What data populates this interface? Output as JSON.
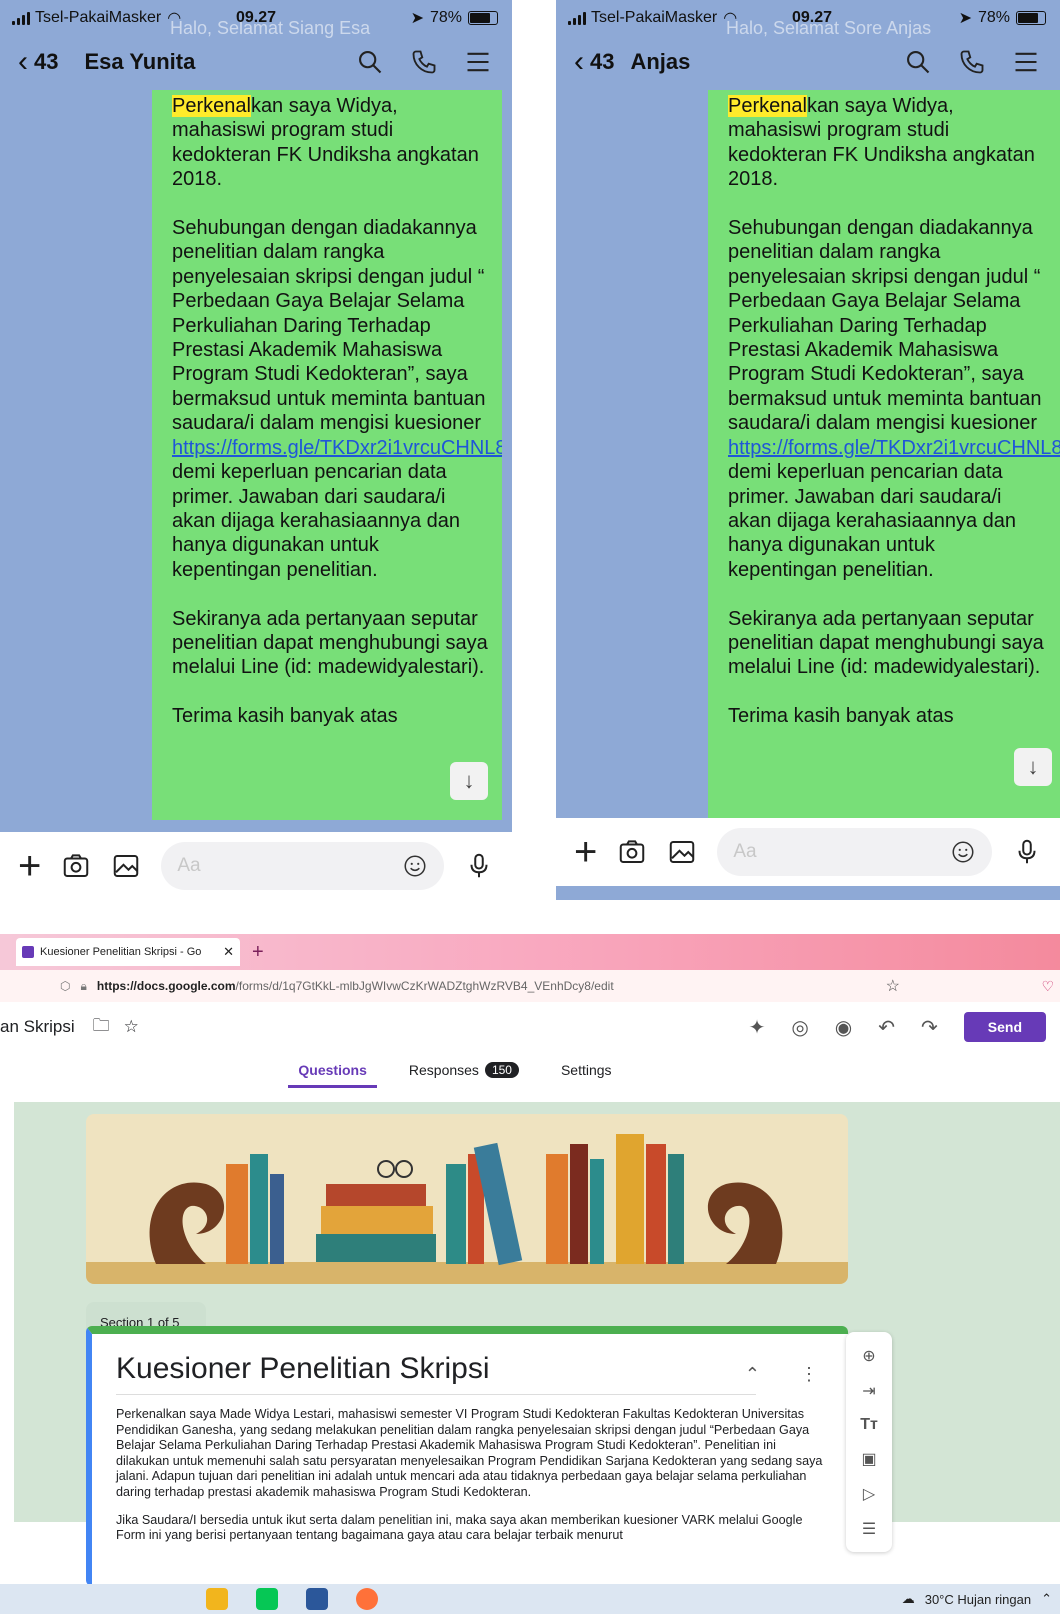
{
  "left_phone": {
    "status": {
      "carrier": "Tsel-PakaiMasker",
      "time": "09.27",
      "battery": "78%"
    },
    "banner": "Halo, Selamat Siang Esa",
    "chat": {
      "back_count": "43",
      "contact": "Esa Yunita"
    },
    "message": {
      "highlight": "Perkenal",
      "p1_rest": "kan saya Widya, mahasiswi program studi kedokteran FK Undiksha angkatan 2018.",
      "p2_before_link": "Sehubungan dengan diadakannya penelitian dalam rangka penyelesaian skripsi dengan judul “ Perbedaan Gaya Belajar Selama Perkuliahan Daring Terhadap Prestasi Akademik Mahasiswa Program Studi Kedokteran”, saya bermaksud untuk meminta bantuan saudara/i dalam mengisi kuesioner ",
      "link": "https://forms.gle/TKDxr2i1vrcuCHNL8",
      "p2_after_link": " demi keperluan pencarian data primer. Jawaban dari saudara/i akan dijaga kerahasiaannya dan hanya digunakan untuk kepentingan penelitian.",
      "p3": "Sekiranya ada pertanyaan seputar penelitian dapat menghubungi saya melalui Line (id: madewidyalestari).",
      "p4": "Terima kasih banyak atas"
    },
    "input_placeholder": "Aa"
  },
  "right_phone": {
    "status": {
      "carrier": "Tsel-PakaiMasker",
      "time": "09.27",
      "battery": "78%"
    },
    "banner": "Halo, Selamat Sore Anjas",
    "chat": {
      "back_count": "43",
      "contact": "Anjas"
    },
    "message": {
      "highlight": "Perkenal",
      "p1_rest": "kan saya Widya, mahasiswi program studi kedokteran FK Undiksha angkatan 2018.",
      "p2_before_link": "Sehubungan dengan diadakannya penelitian dalam rangka penyelesaian skripsi dengan judul “ Perbedaan Gaya Belajar Selama Perkuliahan Daring Terhadap Prestasi Akademik Mahasiswa Program Studi Kedokteran”, saya bermaksud untuk meminta bantuan saudara/i dalam mengisi kuesioner ",
      "link": "https://forms.gle/TKDxr2i1vrcuCHNL8",
      "p2_after_link": " demi keperluan pencarian data primer. Jawaban dari saudara/i akan dijaga kerahasiaannya dan hanya digunakan untuk kepentingan penelitian.",
      "p3": "Sekiranya ada pertanyaan seputar penelitian dapat menghubungi saya melalui Line (id: madewidyalestari).",
      "p4": "Terima kasih banyak atas"
    },
    "input_placeholder": "Aa"
  },
  "browser": {
    "tab_title": "Kuesioner Penelitian Skripsi - Go",
    "url_host": "https://docs.google.com",
    "url_path": "/forms/d/1q7GtKkL-mlbJgWIvwCzKrWADZtghWzRVB4_VEnhDcy8/edit",
    "form_title_trunc": "an Skripsi",
    "send_label": "Send",
    "tabs": {
      "questions": "Questions",
      "responses": "Responses",
      "responses_count": "150",
      "settings": "Settings"
    },
    "section_label": "Section 1 of 5",
    "form_title": "Kuesioner Penelitian Skripsi",
    "desc1": "Perkenalkan saya Made Widya Lestari, mahasiswi semester VI Program Studi Kedokteran Fakultas Kedokteran Universitas Pendidikan Ganesha, yang sedang melakukan penelitian dalam rangka penyelesaian skripsi dengan judul “Perbedaan Gaya Belajar Selama Perkuliahan Daring Terhadap Prestasi Akademik Mahasiswa Program Studi Kedokteran”. Penelitian ini dilakukan untuk memenuhi salah satu persyaratan menyelesaikan Program Pendidikan Sarjana Kedokteran yang sedang saya jalani. Adapun tujuan dari penelitian ini adalah untuk mencari ada atau tidaknya perbedaan gaya belajar selama perkuliahan daring terhadap prestasi akademik mahasiswa Program Studi Kedokteran.",
    "desc2": "Jika Saudara/I bersedia untuk ikut serta dalam penelitian ini, maka saya akan memberikan kuesioner VARK melalui Google Form ini yang berisi pertanyaan tentang bagaimana gaya atau cara belajar terbaik menurut",
    "taskbar_weather": "30°C  Hujan ringan"
  },
  "colors": {
    "bubble": "#78df78",
    "chat_bg": "#8ea9d6",
    "forms_accent": "#673ab7",
    "form_bg": "#d3e5d5"
  }
}
